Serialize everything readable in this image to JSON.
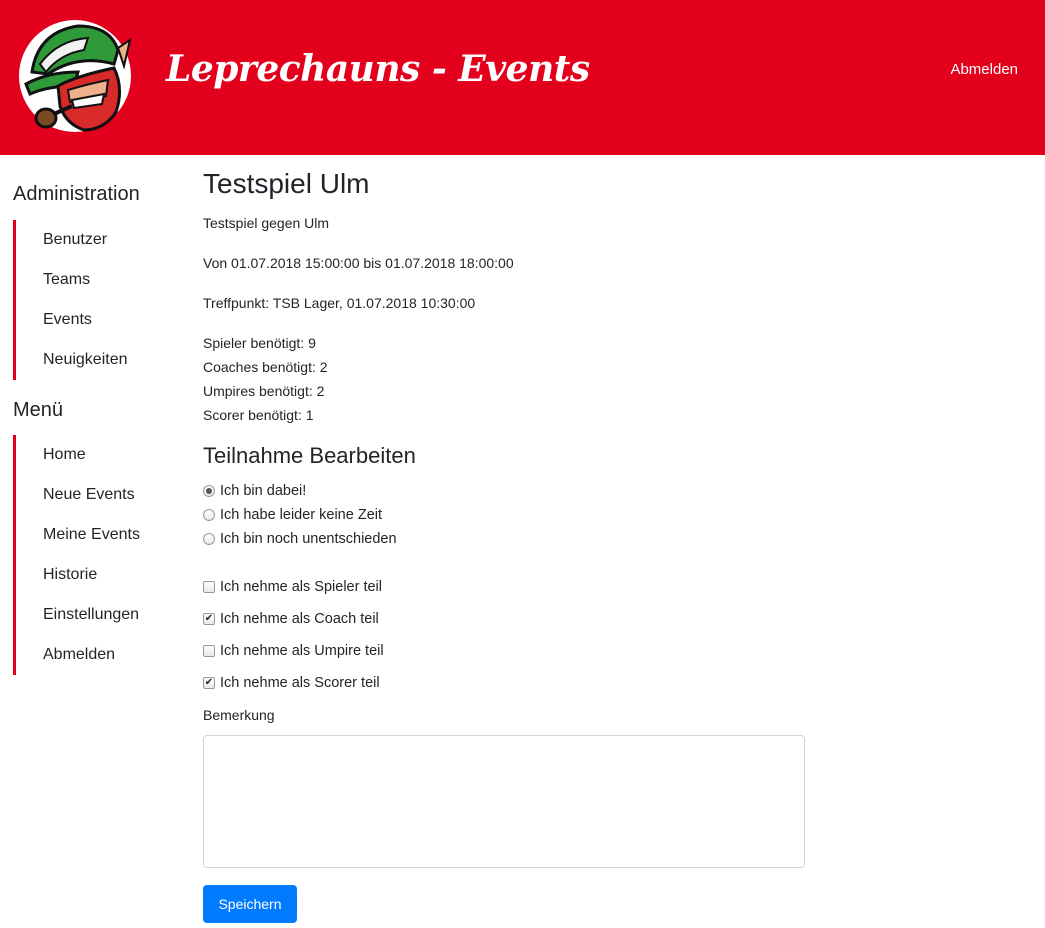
{
  "header": {
    "brand": "Leprechauns - Events",
    "logout": "Abmelden"
  },
  "sidebar": {
    "admin_title": "Administration",
    "admin_items": [
      "Benutzer",
      "Teams",
      "Events",
      "Neuigkeiten"
    ],
    "menu_title": "Menü",
    "menu_items": [
      "Home",
      "Neue Events",
      "Meine Events",
      "Historie",
      "Einstellungen",
      "Abmelden"
    ]
  },
  "event": {
    "title": "Testspiel Ulm",
    "description": "Testspiel gegen Ulm",
    "time": "Von 01.07.2018 15:00:00 bis 01.07.2018 18:00:00",
    "meeting": "Treffpunkt: TSB Lager, 01.07.2018 10:30:00",
    "needs": [
      "Spieler benötigt: 9",
      "Coaches benötigt: 2",
      "Umpires benötigt: 2",
      "Scorer benötigt: 1"
    ]
  },
  "participation": {
    "title": "Teilnahme Bearbeiten",
    "radios": [
      {
        "label": "Ich bin dabei!",
        "checked": true
      },
      {
        "label": "Ich habe leider keine Zeit",
        "checked": false
      },
      {
        "label": "Ich bin noch unentschieden",
        "checked": false
      }
    ],
    "checkboxes": [
      {
        "label": "Ich nehme als Spieler teil",
        "checked": false
      },
      {
        "label": "Ich nehme als Coach teil",
        "checked": true
      },
      {
        "label": "Ich nehme als Umpire teil",
        "checked": false
      },
      {
        "label": "Ich nehme als Scorer teil",
        "checked": true
      }
    ],
    "remark_label": "Bemerkung",
    "remark_value": "",
    "save_label": "Speichern"
  },
  "colors": {
    "brand_red": "#e3001c",
    "primary_blue": "#007bff"
  }
}
